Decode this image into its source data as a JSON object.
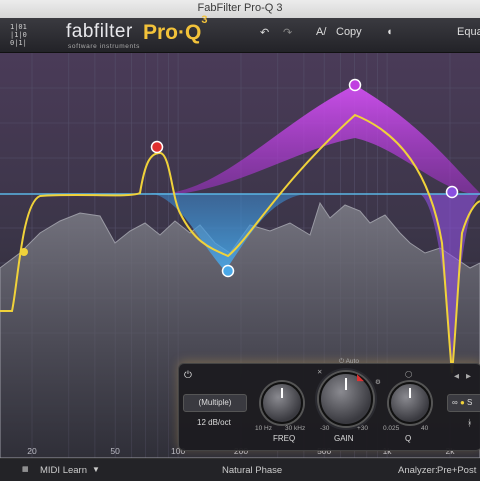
{
  "window": {
    "title": "FabFilter Pro-Q 3"
  },
  "toolbar": {
    "brand": "fabfilter",
    "brand_sub": "software instruments",
    "product": "Pro·Q",
    "product_version": "3",
    "undo_icon": "undo-icon",
    "redo_icon": "redo-icon",
    "ab_label": "A/",
    "copy_label": "Copy",
    "equalizer_label": "Equali"
  },
  "graph": {
    "freq_labels": [
      {
        "text": "20",
        "hz": 20
      },
      {
        "text": "50",
        "hz": 50
      },
      {
        "text": "100",
        "hz": 100
      },
      {
        "text": "200",
        "hz": 200
      },
      {
        "text": "500",
        "hz": 500
      },
      {
        "text": "1k",
        "hz": 1000
      },
      {
        "text": "2k",
        "hz": 2000
      }
    ],
    "colors": {
      "band_purple": "#c040e0",
      "band_blue": "#4aa8e8",
      "curve": "#f0d23a",
      "spectrum": "#8a8a92"
    },
    "band_node_colors": [
      "#f0d23a",
      "#e03030",
      "#4aa8e8",
      "#c040e0",
      "#8a50e0"
    ]
  },
  "panel": {
    "power_icon": "power-icon",
    "selection_button": "(Multiple)",
    "slope": "12 dB/oct",
    "auto_label": "Auto",
    "freq": {
      "label": "FREQ",
      "min": "10 Hz",
      "max": "30 kHz"
    },
    "gain": {
      "label": "GAIN",
      "min": "-30",
      "max": "+30"
    },
    "q": {
      "label": "Q",
      "min": "0.025",
      "max": "40"
    },
    "side_button": "S"
  },
  "bottombar": {
    "midi_learn": "MIDI Learn",
    "phase_mode": "Natural Phase",
    "analyzer_label": "Analyzer:",
    "analyzer_value": "Pre+Post"
  }
}
